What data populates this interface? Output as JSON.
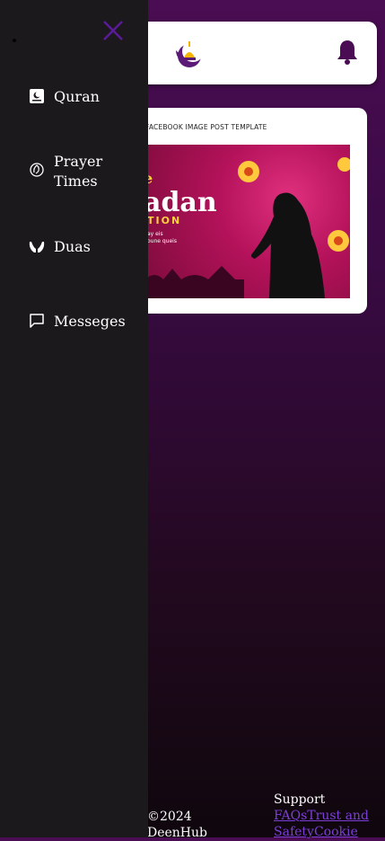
{
  "drawer": {
    "items": [
      {
        "label": "Quran",
        "icon": "book-icon"
      },
      {
        "label": "Prayer Times",
        "icon": "prayer-icon"
      },
      {
        "label": "Duas",
        "icon": "hands-icon"
      },
      {
        "label": "Messeges",
        "icon": "message-icon"
      }
    ]
  },
  "card": {
    "caption": "FACEBOOK IMAGE POST TEMPLATE",
    "poster_word": "adan",
    "poster_yellow": "e",
    "poster_sub": "TION",
    "poster_small_1": "ay eis",
    "poster_small_2": "oune queis"
  },
  "footer": {
    "copyright": "©2024",
    "brand": "DeenHub",
    "support_heading": "Support",
    "links": [
      "FAQs",
      "Trust and Safety",
      "Cookie"
    ]
  },
  "colors": {
    "accent": "#5b1a78",
    "drawer_bg": "#1c191d",
    "link": "#7b3fd6"
  }
}
